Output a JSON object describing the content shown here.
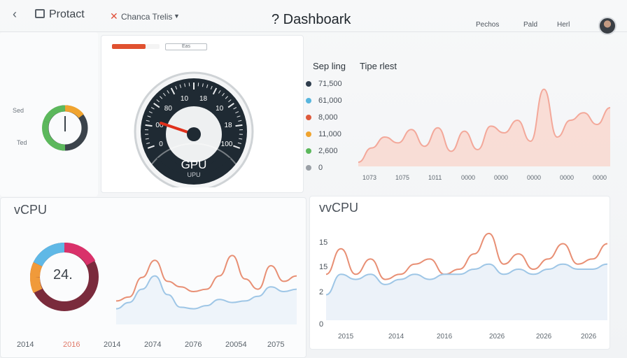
{
  "header": {
    "app_title": "Protact",
    "filter_label": "Chanca Trelis",
    "dashboard_title": "? Dashboark",
    "right_items": [
      "Pechos",
      "Pald",
      "Herl"
    ]
  },
  "top_left": {
    "label_top": "Sed",
    "label_bottom": "Ted"
  },
  "gauge_panel": {
    "mini_input": "Eas",
    "progress": 0.7,
    "gauge_ticks": [
      "0",
      "00",
      "80",
      "10",
      "18",
      "10",
      "18",
      "100"
    ],
    "gauge_title": "GPU",
    "gauge_subtitle": "UPU"
  },
  "legend": {
    "col1": "Sep ling",
    "col2": "Tipe rlest",
    "items": [
      {
        "value": "71,500",
        "color": "#2f3d4d"
      },
      {
        "value": "61,000",
        "color": "#58b6de"
      },
      {
        "value": "8,000",
        "color": "#de5a3c"
      },
      {
        "value": "11,000",
        "color": "#f0a42f"
      },
      {
        "value": "2,600",
        "color": "#5cb85c"
      },
      {
        "value": "0",
        "color": "#9aa0a6"
      }
    ]
  },
  "top_chart": {
    "x_ticks": [
      "1073",
      "1075",
      "1011",
      "0000",
      "0000",
      "0000",
      "0000",
      "0000"
    ]
  },
  "bottom_left": {
    "title": "vCPU",
    "donut_value": "24.",
    "x_ticks": [
      "2014",
      "2016",
      "2014",
      "2074",
      "2076",
      "20054",
      "2075"
    ]
  },
  "bottom_right": {
    "title": "vvCPU",
    "y_ticks": [
      "15",
      "15",
      "2",
      "0"
    ],
    "x_ticks": [
      "2015",
      "2014",
      "2016",
      "2026",
      "2026",
      "2026",
      "2026"
    ]
  },
  "chart_data": [
    {
      "type": "area",
      "title": "",
      "x": [
        "1073",
        "1075",
        "1011",
        "0000",
        "0000",
        "0000",
        "0000",
        "0000"
      ],
      "series": [
        {
          "values": [
            5,
            22,
            35,
            28,
            44,
            24,
            46,
            18,
            42,
            20,
            48,
            40,
            55,
            30,
            92,
            35,
            55,
            64,
            50,
            70
          ]
        }
      ],
      "colors": [
        "#f3a89a"
      ]
    },
    {
      "type": "line",
      "title": "vCPU",
      "x": [
        "2014",
        "2016",
        "2014",
        "2074",
        "2076",
        "20054",
        "2075"
      ],
      "series": [
        {
          "values": [
            30,
            35,
            60,
            82,
            55,
            48,
            42,
            45,
            62,
            88,
            58,
            45,
            75,
            55,
            62
          ],
          "color": "#e88f74"
        },
        {
          "values": [
            20,
            28,
            45,
            62,
            38,
            22,
            20,
            24,
            32,
            28,
            30,
            36,
            48,
            42,
            45
          ],
          "color": "#9ec6e6"
        }
      ]
    },
    {
      "type": "line",
      "title": "vvCPU",
      "ylim": [
        0,
        20
      ],
      "y_ticks": [
        "15",
        "15",
        "2",
        "0"
      ],
      "x": [
        "2015",
        "2014",
        "2016",
        "2026",
        "2026",
        "2026",
        "2026"
      ],
      "series": [
        {
          "values": [
            9,
            14,
            9,
            12,
            8,
            9,
            11,
            12,
            9,
            10,
            13,
            17,
            11,
            13,
            10,
            12,
            15,
            11,
            12,
            15
          ],
          "color": "#e88f74"
        },
        {
          "values": [
            5,
            9,
            8,
            9,
            7,
            8,
            9,
            8,
            9,
            9,
            10,
            11,
            9,
            10,
            9,
            10,
            11,
            10,
            10,
            11
          ],
          "color": "#9ec6e6"
        }
      ]
    }
  ]
}
